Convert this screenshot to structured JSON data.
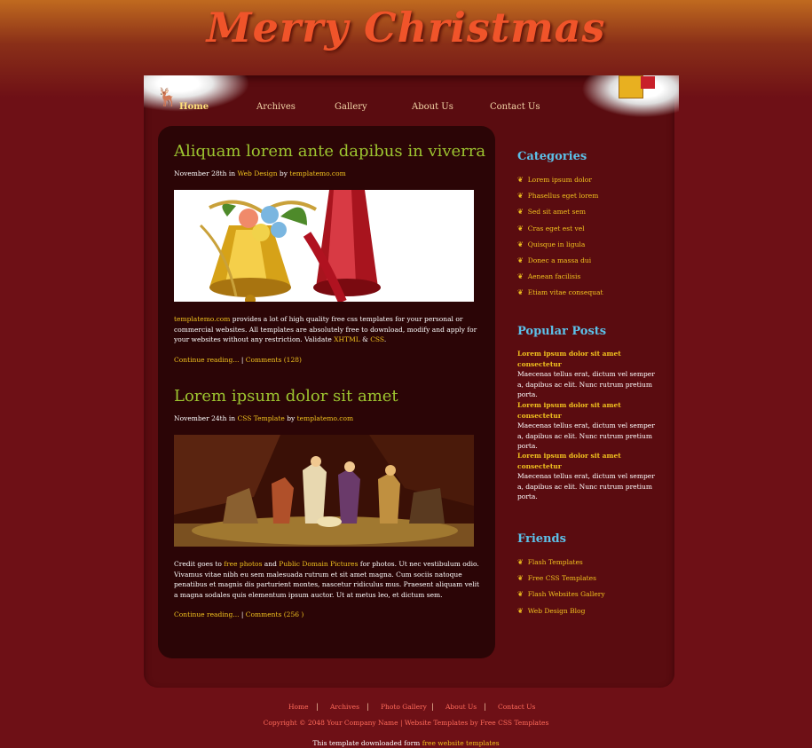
{
  "site": {
    "title": "Merry Christmas"
  },
  "nav": [
    {
      "label": "Home"
    },
    {
      "label": "Archives"
    },
    {
      "label": "Gallery"
    },
    {
      "label": "About Us"
    },
    {
      "label": "Contact Us"
    }
  ],
  "posts": [
    {
      "title": "Aliquam lorem ante dapibus in viverra",
      "meta_date": "November 28th in",
      "meta_category": "Web Design",
      "meta_by": "by",
      "meta_author": "templatemo.com",
      "image_icon": "christmas-bells-image",
      "text_link": "templatemo.com",
      "text_body": " provides a lot of high quality free css templates for your personal or commercial websites. All templates are absolutely free to download, modify and apply for your websites without any restriction. Validate ",
      "text_xhtml": "XHTML",
      "text_amp": " & ",
      "text_css": "CSS",
      "text_end": ".",
      "continue": "Continue reading...",
      "sep": " | ",
      "comments": "Comments (128)"
    },
    {
      "title": "Lorem ipsum dolor sit amet",
      "meta_date": "November 24th in",
      "meta_category": "CSS Template",
      "meta_by": "by",
      "meta_author": "templatemo.com",
      "image_icon": "nativity-scene-image",
      "text_start": "Credit goes to ",
      "text_link1": "free photos",
      "text_and": " and ",
      "text_link2": "Public Domain Pictures",
      "text_body": " for photos. Ut nec vestibulum odio. Vivamus vitae nibh eu sem malesuada rutrum et sit amet magna. Cum sociis natoque penatibus et magnis dis parturient montes, nascetur ridiculus mus. Praesent aliquam velit a magna sodales quis elementum ipsum auctor. Ut at metus leo, et dictum sem.",
      "continue": "Continue reading...",
      "sep": " | ",
      "comments": "Comments (256 )"
    }
  ],
  "sidebar": {
    "categories_title": "Categories",
    "categories": [
      "Lorem ipsum dolor",
      "Phasellus eget lorem",
      "Sed sit amet sem",
      "Cras eget est vel",
      "Quisque in ligula",
      "Donec a massa dui",
      "Aenean facilisis",
      "Etiam vitae consequat"
    ],
    "popular_title": "Popular Posts",
    "popular": [
      {
        "title": "Lorem ipsum dolor sit amet consectetur",
        "body": "Maecenas tellus erat, dictum vel semper a, dapibus ac elit. Nunc rutrum pretium porta."
      },
      {
        "title": "Lorem ipsum dolor sit amet consectetur",
        "body": "Maecenas tellus erat, dictum vel semper a, dapibus ac elit. Nunc rutrum pretium porta."
      },
      {
        "title": "Lorem ipsum dolor sit amet consectetur",
        "body": "Maecenas tellus erat, dictum vel semper a, dapibus ac elit. Nunc rutrum pretium porta."
      }
    ],
    "friends_title": "Friends",
    "friends": [
      "Flash Templates",
      "Free CSS Templates",
      "Flash Websites Gallery",
      "Web Design Blog"
    ]
  },
  "footer": {
    "nav": [
      "Home",
      "Archives",
      "Photo Gallery",
      "About Us",
      "Contact Us"
    ],
    "separator": "|",
    "copyright": "Copyright © 2048 Your Company Name | Website Templates by Free CSS Templates",
    "download_text": "This template downloaded form ",
    "download_link": "free website templates"
  },
  "colors": {
    "background": "#6e1016",
    "content_panel": "#2b0506",
    "post_title": "#9dc530",
    "link": "#f1c21f",
    "sidebar_heading": "#5cc0e8",
    "footer_link": "#ff6a5a"
  }
}
